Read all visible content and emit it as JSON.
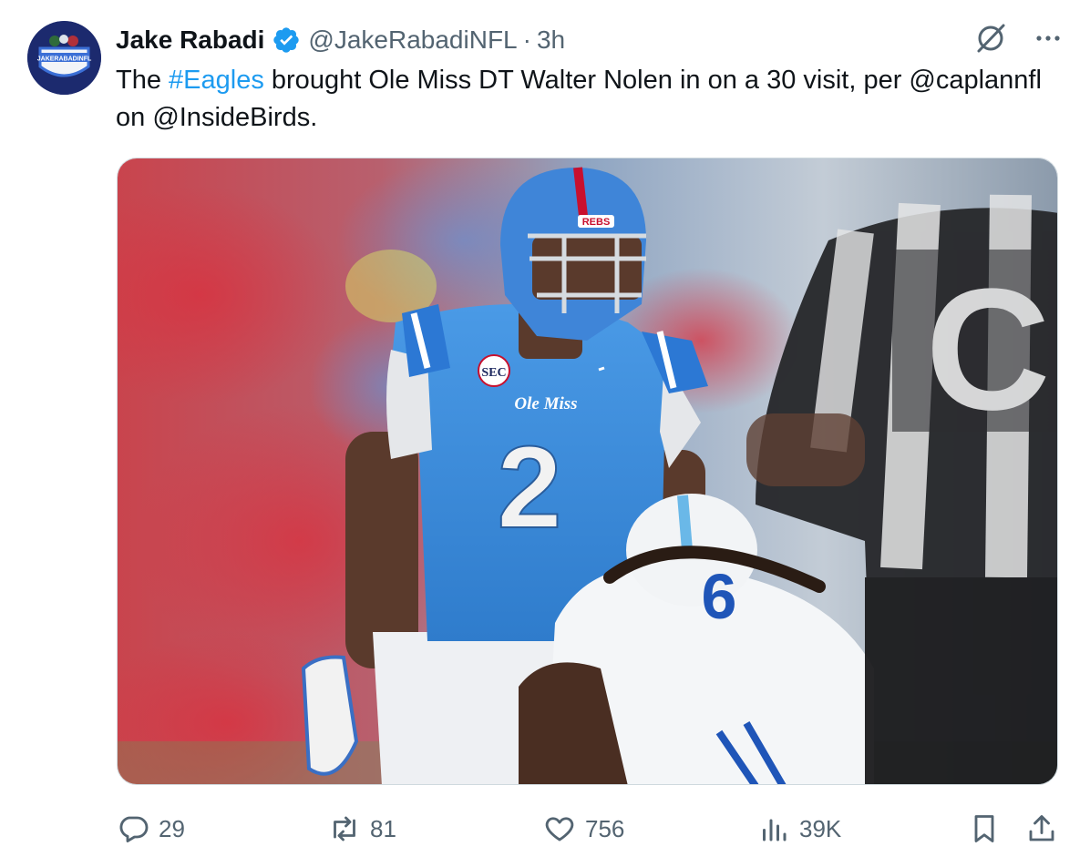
{
  "author": {
    "display_name": "Jake Rabadi",
    "handle": "@JakeRabadiNFL",
    "separator": "·",
    "time": "3h",
    "avatar_text": "JAKERABADINFL",
    "verified_color": "#1d9bf0"
  },
  "tweet": {
    "text_before": "The ",
    "hashtag": "#Eagles",
    "text_after": " brought Ole Miss DT Walter Nolen in on a 30 visit, per @caplannfl on @InsideBirds."
  },
  "media": {
    "jersey_text": "Ole Miss",
    "jersey_number": "2",
    "helmet_text": "REBS",
    "patch_text": "SEC",
    "opponent_number": "6",
    "referee_letter": "C"
  },
  "actions": {
    "replies": "29",
    "reposts": "81",
    "likes": "756",
    "views": "39K"
  },
  "icons": {
    "reply": "reply-icon",
    "repost": "repost-icon",
    "like": "heart-icon",
    "views": "views-icon",
    "bookmark": "bookmark-icon",
    "share": "share-icon",
    "grok": "grok-icon",
    "more": "more-icon"
  },
  "colors": {
    "link": "#1d9bf0",
    "secondary_text": "#536471",
    "jersey_blue": "#3a8ad8"
  }
}
